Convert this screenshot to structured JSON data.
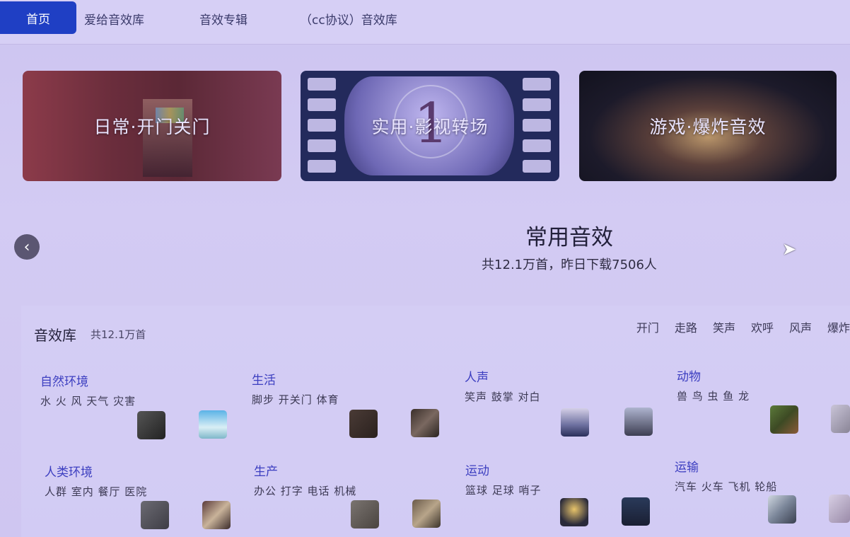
{
  "nav": {
    "items": [
      "首页",
      "爱给音效库",
      "音效专辑",
      "（cc协议）音效库"
    ]
  },
  "banners": [
    {
      "title": "日常·开门关门"
    },
    {
      "title": "实用·影视转场"
    },
    {
      "title": "游戏·爆炸音效"
    }
  ],
  "banner_film_number": "1",
  "prev_icon": "‹",
  "hero": {
    "title": "常用音效",
    "subtitle": "共12.1万首，昨日下载7506人"
  },
  "library": {
    "title": "音效库",
    "count": "共12.1万首",
    "tags": [
      "开门",
      "走路",
      "笑声",
      "欢呼",
      "风声",
      "爆炸"
    ],
    "categories": [
      {
        "name": "自然环境",
        "sub": "水 火 风 天气 灾害"
      },
      {
        "name": "生活",
        "sub": "脚步 开关门 体育"
      },
      {
        "name": "人声",
        "sub": "笑声 鼓掌 对白"
      },
      {
        "name": "动物",
        "sub": "兽 鸟 虫 鱼 龙"
      },
      {
        "name": "人类环境",
        "sub": "人群 室内 餐厅 医院"
      },
      {
        "name": "生产",
        "sub": "办公 打字 电话 机械"
      },
      {
        "name": "运动",
        "sub": "篮球 足球 哨子"
      },
      {
        "name": "运输",
        "sub": "汽车 火车 飞机 轮船"
      }
    ]
  },
  "colors": {
    "accent": "#1f3fc4",
    "category_link": "#3c3ec0",
    "background": "#cfc6f1"
  }
}
